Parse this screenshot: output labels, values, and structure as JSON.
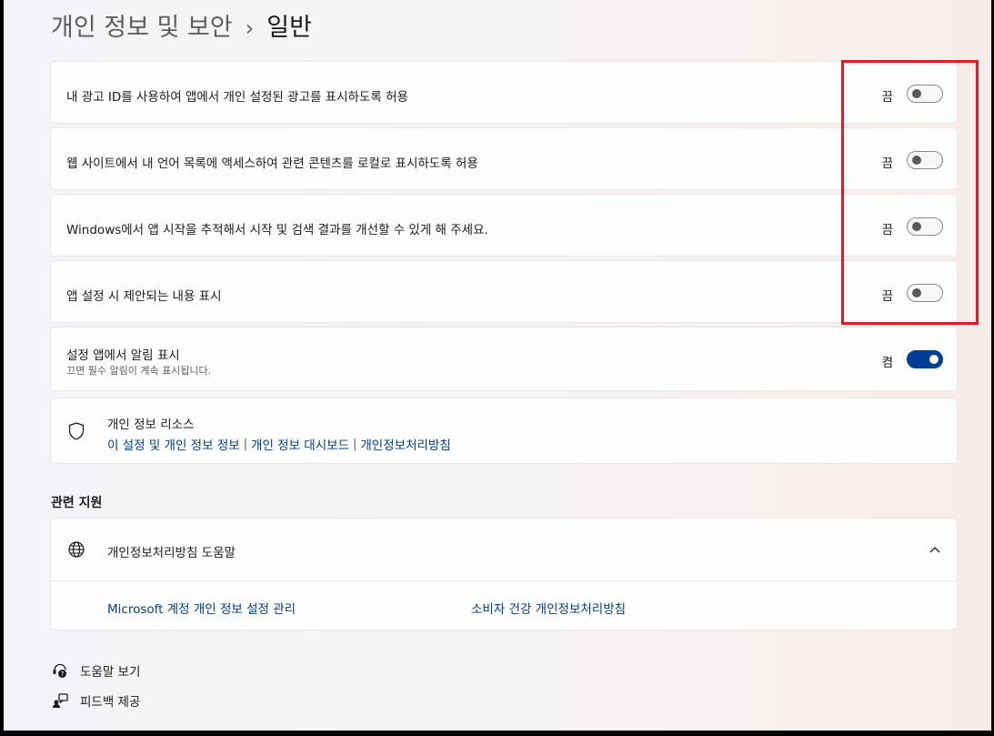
{
  "breadcrumb": {
    "parent": "개인 정보 및 보안",
    "separator": "›",
    "current": "일반"
  },
  "settings": [
    {
      "label": "내 광고 ID를 사용하여 앱에서 개인 설정된 광고를 표시하도록 허용",
      "state": "끔",
      "on": false
    },
    {
      "label": "웹 사이트에서 내 언어 목록에 액세스하여 관련 콘텐츠를 로컬로 표시하도록 허용",
      "state": "끔",
      "on": false
    },
    {
      "label": "Windows에서 앱 시작을 추적해서 시작 및 검색 결과를 개선할 수 있게 해 주세요.",
      "state": "끔",
      "on": false
    },
    {
      "label": "앱 설정 시 제안되는 내용 표시",
      "state": "끔",
      "on": false
    },
    {
      "label": "설정 앱에서 알림 표시",
      "description": "끄면 필수 알림이 계속 표시됩니다.",
      "state": "켬",
      "on": true
    }
  ],
  "privacy_resources": {
    "title": "개인 정보 리소스",
    "links": [
      "이 설정 및 개인 정보 정보",
      "개인 정보 대시보드",
      "개인정보처리방침"
    ],
    "separator": "|"
  },
  "related_support": {
    "heading": "관련 지원",
    "item_title": "개인정보처리방침 도움말",
    "links": [
      "Microsoft 계정 개인 정보 설정 관리",
      "소비자 건강 개인정보처리방침"
    ]
  },
  "footer": {
    "help": "도움말 보기",
    "feedback": "피드백 제공"
  },
  "colors": {
    "accent": "#003e92",
    "highlight_border": "#e31b23"
  },
  "icons": {
    "shield": "shield-icon",
    "globe": "globe-icon",
    "chevron": "chevron-up-icon",
    "help": "help-icon",
    "feedback": "feedback-icon"
  }
}
